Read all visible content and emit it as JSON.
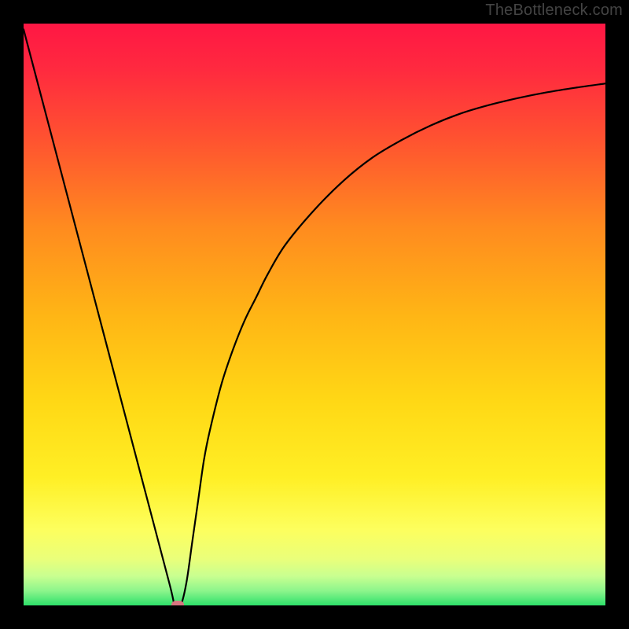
{
  "watermark": "TheBottleneck.com",
  "chart_data": {
    "type": "line",
    "title": "",
    "xlabel": "",
    "ylabel": "",
    "xlim": [
      0,
      100
    ],
    "ylim": [
      0,
      100
    ],
    "series": [
      {
        "name": "curve",
        "x": [
          0,
          5,
          10,
          15,
          20,
          25,
          26,
          27,
          28,
          29,
          30,
          31,
          32,
          34,
          36,
          38,
          40,
          42,
          45,
          50,
          55,
          60,
          65,
          70,
          75,
          80,
          85,
          90,
          95,
          100
        ],
        "values": [
          99,
          80,
          61,
          42,
          23,
          4,
          0,
          0,
          4,
          11,
          18,
          25,
          30,
          38,
          44,
          49,
          53,
          57,
          62,
          68,
          73,
          77,
          80,
          82.5,
          84.5,
          86,
          87.2,
          88.2,
          89,
          89.7
        ]
      }
    ],
    "marker": {
      "x": 26.5,
      "y": 0
    },
    "gradient_stops": [
      {
        "offset": 0.0,
        "color": "#ff1744"
      },
      {
        "offset": 0.08,
        "color": "#ff2a3f"
      },
      {
        "offset": 0.2,
        "color": "#ff5330"
      },
      {
        "offset": 0.35,
        "color": "#ff8b1f"
      },
      {
        "offset": 0.5,
        "color": "#ffb515"
      },
      {
        "offset": 0.65,
        "color": "#ffd815"
      },
      {
        "offset": 0.78,
        "color": "#ffef25"
      },
      {
        "offset": 0.87,
        "color": "#fdff5e"
      },
      {
        "offset": 0.92,
        "color": "#eaff7a"
      },
      {
        "offset": 0.95,
        "color": "#c8ff90"
      },
      {
        "offset": 0.975,
        "color": "#8cf58c"
      },
      {
        "offset": 1.0,
        "color": "#2ee06a"
      }
    ]
  }
}
